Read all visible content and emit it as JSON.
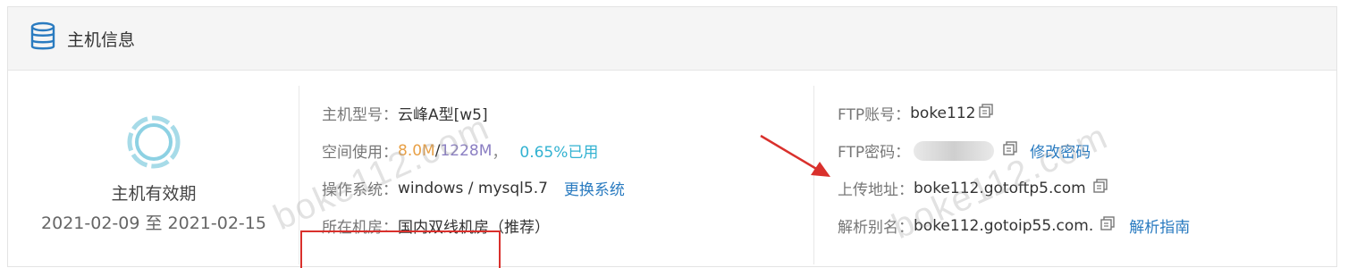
{
  "panel": {
    "title": "主机信息",
    "icon": "database-icon"
  },
  "validity": {
    "label": "主机有效期",
    "range": "2021-02-09 至 2021-02-15"
  },
  "host": {
    "model_label": "主机型号：",
    "model_value": "云峰A型[w5]",
    "space_label": "空间使用：",
    "space_used": "8.0M",
    "space_sep": " / ",
    "space_total": "1228M",
    "space_comma": "，",
    "space_percent": "0.65%已用",
    "os_label": "操作系统：",
    "os_value": "windows / mysql5.7",
    "os_link": "更换系统",
    "room_label": "所在机房：",
    "room_value": "国内双线机房（推荐）"
  },
  "ftp": {
    "account_label": "FTP账号：",
    "account_value": "boke112",
    "password_label": "FTP密码：",
    "password_link": "修改密码",
    "upload_label": "上传地址：",
    "upload_value": "boke112.gotoftp5.com",
    "alias_label": "解析别名：",
    "alias_value": "boke112.gotoip55.com.",
    "alias_link": "解析指南"
  },
  "watermark": {
    "text1": "boke112.com",
    "text2": "boke112.com"
  },
  "colors": {
    "accent_red": "#d9302c",
    "link": "#2a7bc0",
    "used": "#e8a046",
    "total": "#8b7fc3",
    "percent": "#32b2d1"
  }
}
